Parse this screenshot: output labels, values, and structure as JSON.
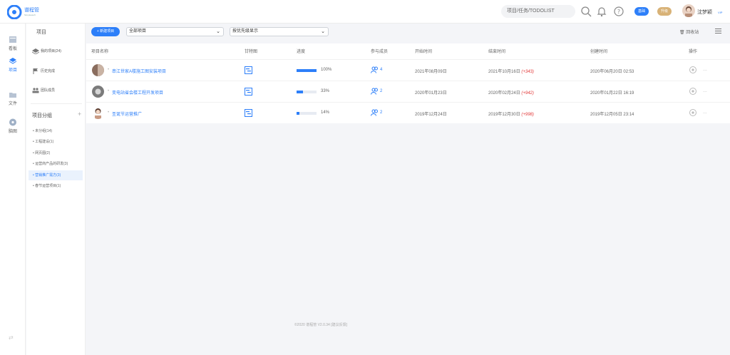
{
  "brand": {
    "name": "谱程管",
    "sub": "Simpleasoft"
  },
  "topbar": {
    "search_label": "项目/任务/TODOLIST",
    "pill_basic": "基础",
    "pill_upgrade": "升级",
    "user_name": "沈梦颖",
    "user_badge": "VIP"
  },
  "rail": [
    {
      "label": "看板",
      "icon": "board-icon"
    },
    {
      "label": "项目",
      "icon": "project-icon",
      "active": true
    },
    {
      "label": "文件",
      "icon": "folder-icon"
    },
    {
      "label": "脑图",
      "icon": "mindmap-icon"
    }
  ],
  "sidebar": {
    "title": "项目",
    "items": [
      {
        "label": "我的项目(24)",
        "icon": "layers-icon"
      },
      {
        "label": "历史完成",
        "icon": "flag-icon"
      },
      {
        "label": "团队成员",
        "icon": "team-icon"
      }
    ],
    "group_title": "项目分组",
    "groups": [
      {
        "label": "• 未分组(14)"
      },
      {
        "label": "• 工程建设(1)"
      },
      {
        "label": "• 网页图(2)"
      },
      {
        "label": "• 运营商产品的研发(3)"
      },
      {
        "label": "• 营销推广需方(3)",
        "active": true
      },
      {
        "label": "• 春节运营项目(1)"
      }
    ]
  },
  "toolbar": {
    "new_button": "+ 新建项目",
    "filter_all": "全部项目",
    "sort_label": "按优先级显示",
    "recycle": "回收站"
  },
  "table": {
    "columns": [
      "项目名称",
      "甘特图",
      "进度",
      "参与成员",
      "开始时间",
      "结束时间",
      "创建时间",
      "操作"
    ],
    "rows": [
      {
        "name": "串江世家A楼施工图安装项目",
        "progress": 1.0,
        "progress_text": "100%",
        "members": "4",
        "start": "2021年08月09日",
        "end": "2021年10月16日",
        "delay": "(+343)",
        "created": "2020年06月20日 02:53"
      },
      {
        "name": "变电站省会楼工程开发项目",
        "progress": 0.33,
        "progress_text": "33%",
        "members": "2",
        "start": "2020年01月23日",
        "end": "2020年02月24日",
        "delay": "(+942)",
        "created": "2020年01月22日 16:19"
      },
      {
        "name": "圣诞节运营推广",
        "progress": 0.14,
        "progress_text": "14%",
        "members": "2",
        "start": "2019年12月24日",
        "end": "2019年12月30日",
        "delay": "(+998)",
        "created": "2019年12月05日 23:14"
      }
    ]
  },
  "footer": "©2020 谱程管 V2.0.34 [建议反馈]",
  "colors": {
    "accent": "#2d7ff9",
    "delay": "#e23a3a"
  }
}
